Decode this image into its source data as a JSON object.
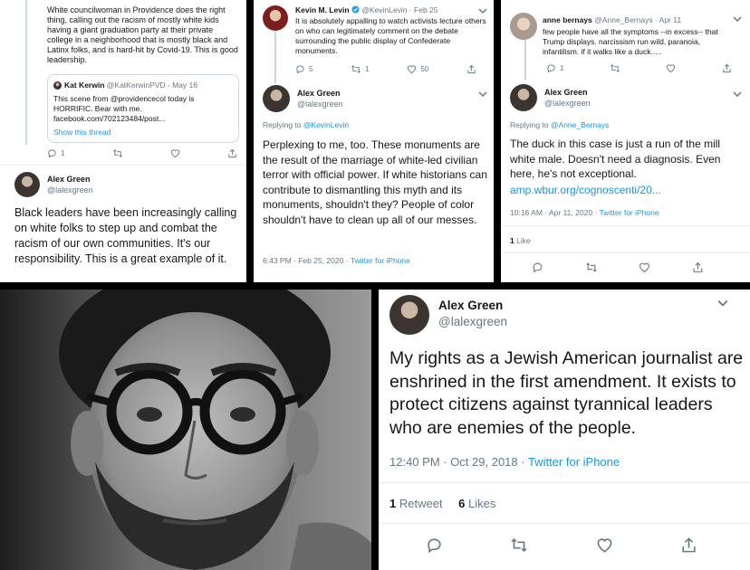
{
  "panel1": {
    "top_text": "White councilwoman in Providence does the right thing, calling out the racism of mostly white kids having a giant graduation party at their private college in a neighborhood that is mostly black and Latinx folks, and is hard-hit by Covid-19. This is good leadership.",
    "quoted": {
      "name": "Kat Kerwin",
      "handle_date": "@KatKerwinPVD · May 16",
      "text": "This scene from @providencecol today is HORRIFIC. Bear with me. facebook.com/702123484/post...",
      "show_thread": "Show this thread"
    },
    "reply_count": "1",
    "reply": {
      "name": "Alex Green",
      "handle": "@lalexgreen",
      "text": "Black leaders have been increasingly calling on white folks to step up and combat the racism of our own communities. It's our responsibility. This is a great example of it."
    }
  },
  "panel2": {
    "top": {
      "name": "Kevin M. Levin",
      "handle_date": "@KevinLevin · Feb 25",
      "text": "It is absolutely appalling to watch activists lecture others on who can legitimately comment on the debate surrounding the public display of Confederate monuments.",
      "reply_count": "5",
      "retweet_count": "1",
      "like_count": "50"
    },
    "reply": {
      "name": "Alex Green",
      "handle": "@lalexgreen",
      "replying_prefix": "Replying to ",
      "replying_handle": "@KevinLevin",
      "text": "Perplexing to me, too. These monuments are the result of the marriage of white-led civilian terror with official power. If white historians can contribute to dismantling this myth and its monuments, shouldn't they? People of color shouldn't have to clean up all of our messes.",
      "timestamp": "6:43 PM · Feb 25, 2020 · ",
      "source": "Twitter for iPhone"
    }
  },
  "panel3": {
    "top": {
      "name": "anne bernays",
      "handle_date": "@Anne_Bernays · Apr 11",
      "text": "few people have all the symptoms --in excess-- that Trump displays. narcissism run wild, paranoia, infantilism. if it walks like a duck.....",
      "reply_count": "1"
    },
    "reply": {
      "name": "Alex Green",
      "handle": "@lalexgreen",
      "replying_prefix": "Replying to ",
      "replying_handle": "@Anne_Bernays",
      "text": "The duck in this case is just a run of the mill white male. Doesn't need a diagnosis. Even here, he's not exceptional.",
      "link": "amp.wbur.org/cognoscenti/20...",
      "timestamp": "10:16 AM · Apr 11, 2020 · ",
      "source": "Twitter for iPhone",
      "likes_num": "1",
      "likes_label": " Like"
    }
  },
  "panel5": {
    "name": "Alex Green",
    "handle": "@lalexgreen",
    "text": "My rights as a Jewish American journalist are enshrined in the first amendment. It exists to protect citizens against tyrannical leaders who are enemies of the people.",
    "timestamp": "12:40 PM · Oct 29, 2018 · ",
    "source": "Twitter for iPhone",
    "retweets_num": "1",
    "retweets_label": " Retweet",
    "likes_num": "6",
    "likes_label": " Likes"
  },
  "icons": {
    "reply": "reply-icon",
    "retweet": "retweet-icon",
    "like": "like-icon",
    "share": "share-icon"
  },
  "colors": {
    "link": "#1b95e0",
    "muted": "#657786",
    "verified": "#1da1f2"
  }
}
